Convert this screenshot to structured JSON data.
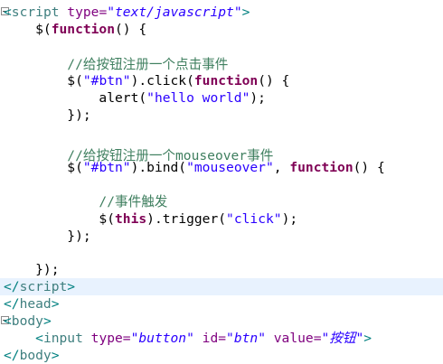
{
  "lines": [
    {
      "id": "script-open",
      "tokens": [
        {
          "t": "<",
          "c": "ang"
        },
        {
          "t": "script",
          "c": "tag"
        },
        {
          "t": " type=",
          "c": "attr"
        },
        {
          "t": "\"text/javascript\"",
          "c": "val"
        },
        {
          "t": ">",
          "c": "ang"
        }
      ]
    },
    {
      "id": "ready-open",
      "tokens": [
        {
          "t": "    $(",
          "c": "plain"
        },
        {
          "t": "function",
          "c": "kw"
        },
        {
          "t": "() {",
          "c": "plain"
        }
      ]
    },
    {
      "id": "blank-1",
      "tokens": []
    },
    {
      "id": "comment-click",
      "tokens": [
        {
          "t": "        //给按钮注册一个点击事件",
          "c": "cmt"
        }
      ]
    },
    {
      "id": "click-bind",
      "tokens": [
        {
          "t": "        $(",
          "c": "plain"
        },
        {
          "t": "\"#btn\"",
          "c": "str"
        },
        {
          "t": ").click(",
          "c": "plain"
        },
        {
          "t": "function",
          "c": "kw"
        },
        {
          "t": "() {",
          "c": "plain"
        }
      ]
    },
    {
      "id": "alert-call",
      "tokens": [
        {
          "t": "            alert(",
          "c": "plain"
        },
        {
          "t": "\"hello world\"",
          "c": "str"
        },
        {
          "t": ");",
          "c": "plain"
        }
      ]
    },
    {
      "id": "click-close",
      "tokens": [
        {
          "t": "        });",
          "c": "plain"
        }
      ]
    },
    {
      "id": "blank-2",
      "tokens": []
    },
    {
      "id": "comment-mouseover",
      "tokens": [
        {
          "t": "        //给按钮注册一个mouseover事件",
          "c": "cmt"
        }
      ]
    },
    {
      "id": "mouseover-bind",
      "tokens": [
        {
          "t": "        $(",
          "c": "plain"
        },
        {
          "t": "\"#btn\"",
          "c": "str"
        },
        {
          "t": ").bind(",
          "c": "plain"
        },
        {
          "t": "\"mouseover\"",
          "c": "str"
        },
        {
          "t": ", ",
          "c": "plain"
        },
        {
          "t": "function",
          "c": "kw"
        },
        {
          "t": "() {",
          "c": "plain"
        }
      ]
    },
    {
      "id": "blank-3",
      "tokens": []
    },
    {
      "id": "comment-trigger",
      "tokens": [
        {
          "t": "            //事件触发",
          "c": "cmt"
        }
      ]
    },
    {
      "id": "trigger-call",
      "tokens": [
        {
          "t": "            $(",
          "c": "plain"
        },
        {
          "t": "this",
          "c": "kw"
        },
        {
          "t": ").trigger(",
          "c": "plain"
        },
        {
          "t": "\"click\"",
          "c": "str"
        },
        {
          "t": ");",
          "c": "plain"
        }
      ]
    },
    {
      "id": "mouseover-close",
      "tokens": [
        {
          "t": "        });",
          "c": "plain"
        }
      ]
    },
    {
      "id": "blank-4",
      "tokens": []
    },
    {
      "id": "ready-close",
      "tokens": [
        {
          "t": "    });",
          "c": "plain"
        }
      ]
    },
    {
      "id": "script-close",
      "current": true,
      "tokens": [
        {
          "t": "</",
          "c": "ang"
        },
        {
          "t": "script",
          "c": "tag"
        },
        {
          "t": ">",
          "c": "ang"
        }
      ]
    },
    {
      "id": "head-close",
      "tokens": [
        {
          "t": "</",
          "c": "ang"
        },
        {
          "t": "head",
          "c": "tag"
        },
        {
          "t": ">",
          "c": "ang"
        }
      ]
    },
    {
      "id": "body-open",
      "fold": true,
      "tokens": [
        {
          "t": "<",
          "c": "ang"
        },
        {
          "t": "body",
          "c": "tag"
        },
        {
          "t": ">",
          "c": "ang"
        }
      ]
    },
    {
      "id": "input-tag",
      "tokens": [
        {
          "t": "    <",
          "c": "ang"
        },
        {
          "t": "input",
          "c": "tag"
        },
        {
          "t": " type=",
          "c": "attr"
        },
        {
          "t": "\"button\"",
          "c": "val"
        },
        {
          "t": " id=",
          "c": "attr"
        },
        {
          "t": "\"btn\"",
          "c": "val"
        },
        {
          "t": " value=",
          "c": "attr"
        },
        {
          "t": "\"按钮\"",
          "c": "val"
        },
        {
          "t": ">",
          "c": "ang"
        }
      ]
    },
    {
      "id": "body-close",
      "tokens": [
        {
          "t": "</",
          "c": "ang"
        },
        {
          "t": "body",
          "c": "tag"
        },
        {
          "t": ">",
          "c": "ang"
        }
      ]
    }
  ],
  "fold_markers": [
    "script-open"
  ]
}
